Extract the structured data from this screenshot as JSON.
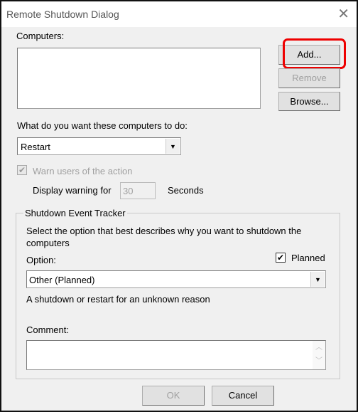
{
  "window": {
    "title": "Remote Shutdown Dialog",
    "close_icon": "close-icon"
  },
  "computers": {
    "label": "Computers:",
    "items": []
  },
  "buttons": {
    "add": "Add...",
    "remove": "Remove",
    "browse": "Browse...",
    "ok": "OK",
    "cancel": "Cancel"
  },
  "action": {
    "label": "What do you want these computers to do:",
    "selected": "Restart"
  },
  "warn": {
    "label": "Warn users of the action",
    "checked": true,
    "disabled": true,
    "display_label": "Display warning for",
    "seconds_value": "30",
    "seconds_label": "Seconds"
  },
  "tracker": {
    "title": "Shutdown Event Tracker",
    "instructions": "Select the option that best describes why you want to shutdown the computers",
    "option_label": "Option:",
    "planned_label": "Planned",
    "planned_checked": true,
    "option_selected": "Other (Planned)",
    "description": "A shutdown or restart for an unknown reason",
    "comment_label": "Comment:",
    "comment_value": ""
  },
  "highlight": {
    "color": "#e00000",
    "target": "Add..."
  }
}
